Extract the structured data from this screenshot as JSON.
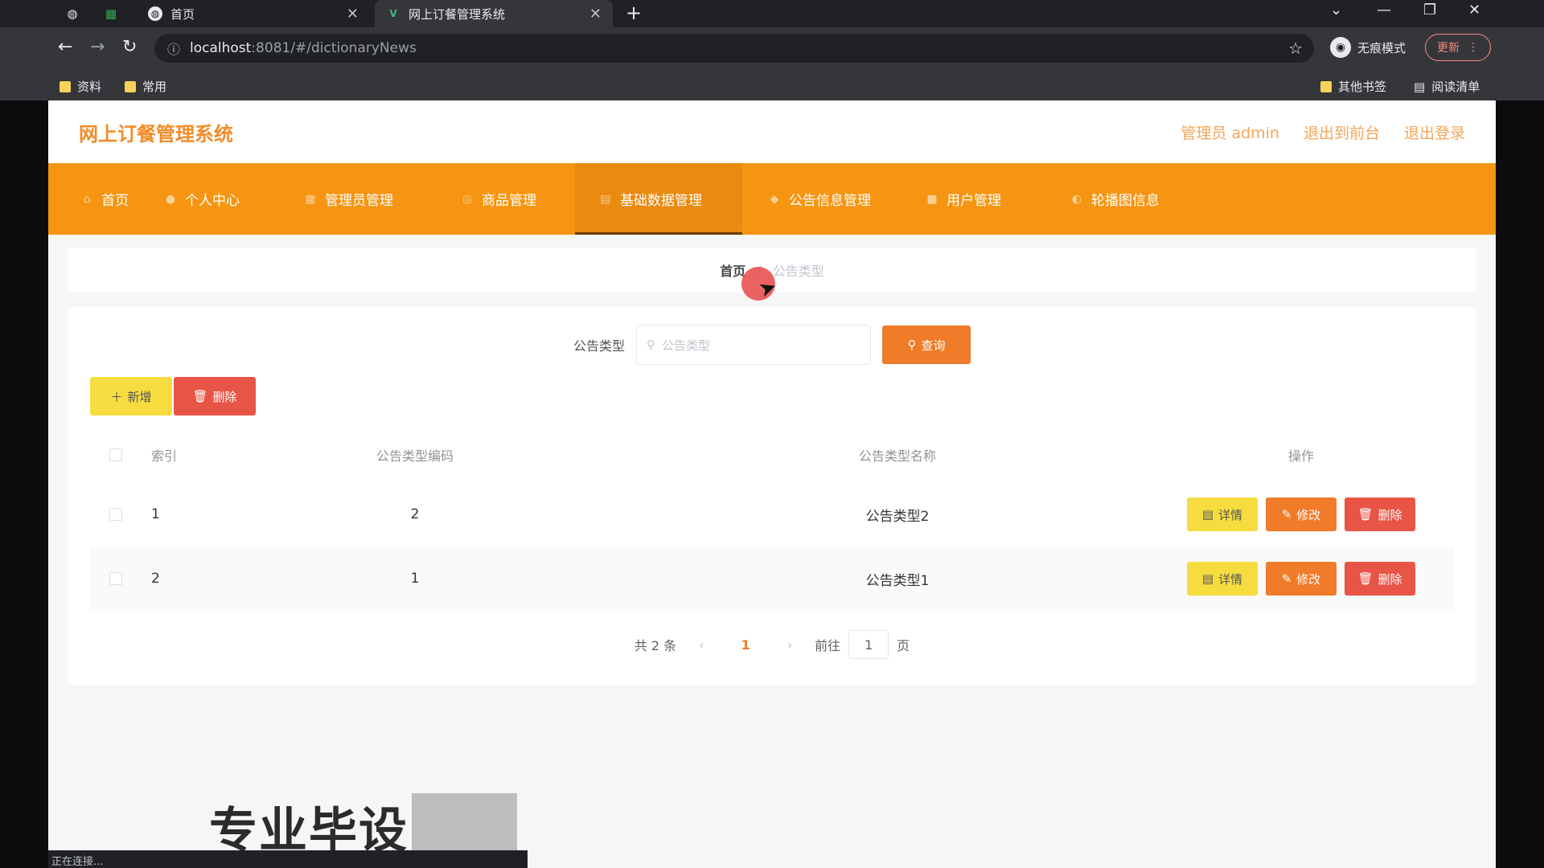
{
  "browser": {
    "tabs": [
      {
        "label": "首页",
        "active": false
      },
      {
        "label": "网上订餐管理系统",
        "active": true
      }
    ],
    "url_host": "localhost",
    "url_path": ":8081/#/dictionaryNews",
    "incognito_label": "无痕模式",
    "update_label": "更新",
    "bookmarks_left": [
      "资料",
      "常用"
    ],
    "bookmarks_right": [
      "其他书签",
      "阅读清单"
    ],
    "status_text": "正在连接..."
  },
  "app": {
    "title": "网上订餐管理系统",
    "header_links": [
      "管理员 admin",
      "退出到前台",
      "退出登录"
    ],
    "nav": [
      {
        "label": "首页",
        "icon": "home-icon"
      },
      {
        "label": "个人中心",
        "icon": "user-icon"
      },
      {
        "label": "管理员管理",
        "icon": "grid-icon"
      },
      {
        "label": "商品管理",
        "icon": "goods-icon"
      },
      {
        "label": "基础数据管理",
        "icon": "data-icon",
        "active": true
      },
      {
        "label": "公告信息管理",
        "icon": "notice-icon"
      },
      {
        "label": "用户管理",
        "icon": "users-icon"
      },
      {
        "label": "轮播图信息",
        "icon": "carousel-icon"
      }
    ],
    "breadcrumb": {
      "home": "首页",
      "separator": "/",
      "current": "公告类型"
    },
    "search": {
      "label": "公告类型",
      "placeholder": "公告类型",
      "button": "查询"
    },
    "actions": {
      "add": "新增",
      "delete": "删除"
    },
    "table": {
      "headers": {
        "index": "索引",
        "code": "公告类型编码",
        "name": "公告类型名称",
        "ops": "操作"
      },
      "rows": [
        {
          "index": "1",
          "code": "2",
          "name": "公告类型2"
        },
        {
          "index": "2",
          "code": "1",
          "name": "公告类型1"
        }
      ],
      "row_actions": {
        "detail": "详情",
        "edit": "修改",
        "delete": "删除"
      }
    },
    "pagination": {
      "total": "共 2 条",
      "current": "1",
      "goto": "前往",
      "goto_value": "1",
      "page_unit": "页"
    },
    "colors": {
      "accent": "#f69512",
      "brand": "#f28c28",
      "danger": "#e85546",
      "warning": "#f7dc3f"
    }
  },
  "overlay": {
    "watermark": "专业毕设"
  }
}
